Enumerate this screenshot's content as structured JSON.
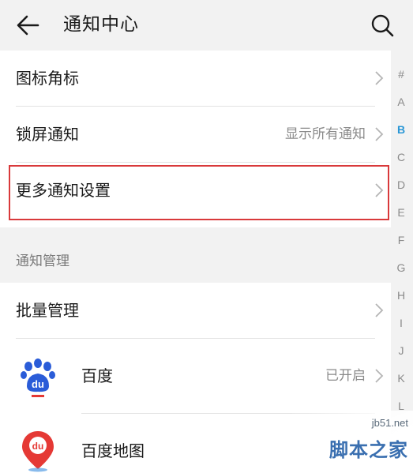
{
  "header": {
    "title": "通知中心",
    "back_icon": "arrow-left-icon",
    "search_icon": "search-icon"
  },
  "settings": {
    "icon_badge": {
      "label": "图标角标"
    },
    "lock_screen": {
      "label": "锁屏通知",
      "value": "显示所有通知"
    },
    "more_settings": {
      "label": "更多通知设置"
    }
  },
  "notification_management": {
    "section_title": "通知管理",
    "batch_label": "批量管理",
    "apps": [
      {
        "name": "百度",
        "status": "已开启",
        "icon": "baidu-paw-icon"
      },
      {
        "name": "百度地图",
        "status": "",
        "icon": "baidu-map-pin-icon"
      }
    ]
  },
  "index_bar": {
    "letters": [
      "#",
      "A",
      "B",
      "C",
      "D",
      "E",
      "F",
      "G",
      "H",
      "I",
      "J",
      "K",
      "L"
    ],
    "active": "B"
  },
  "watermark": {
    "url": "jb51.net",
    "name": "脚本之家"
  },
  "colors": {
    "background": "#f2f2f2",
    "card": "#ffffff",
    "highlight_border": "#d9393b",
    "index_active": "#2a97d6",
    "baidu_blue": "#2a5cd8",
    "baidu_red": "#e53935"
  }
}
